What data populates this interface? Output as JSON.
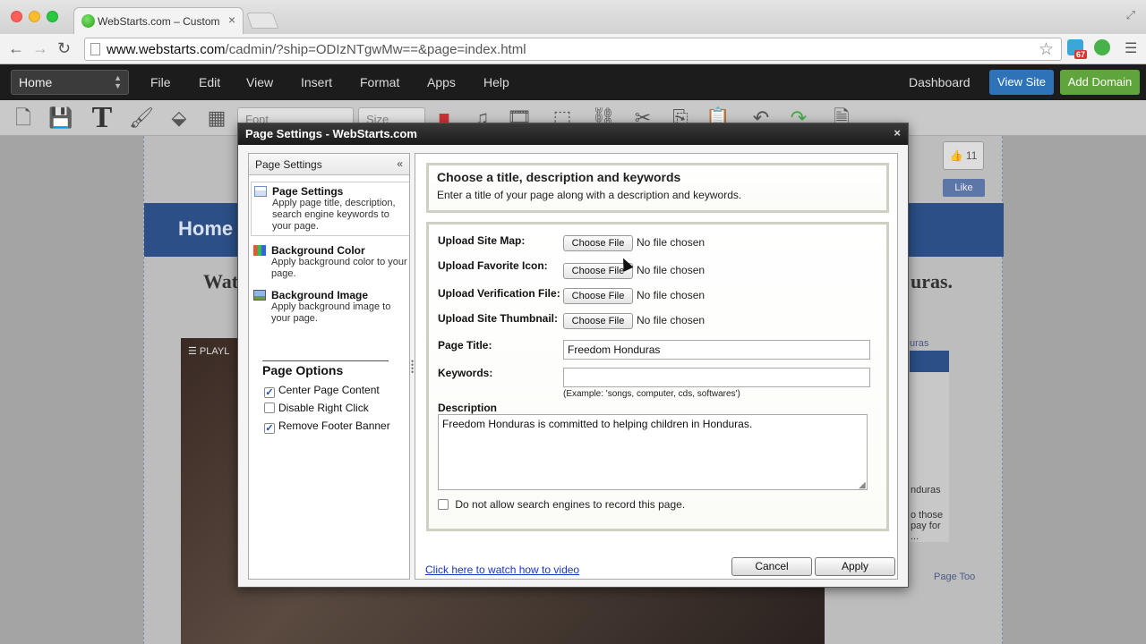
{
  "browser": {
    "tab_title": "WebStarts.com – Custom W",
    "tab_close": "×",
    "url_host": "www.webstarts.com",
    "url_path": "/cadmin/?ship=ODIzNTgwMw==&page=index.html",
    "ext_badge": "67"
  },
  "appbar": {
    "page_select": "Home",
    "menus": [
      "File",
      "Edit",
      "View",
      "Insert",
      "Format",
      "Apps",
      "Help"
    ],
    "dashboard": "Dashboard",
    "view_site": "View Site",
    "add_domain": "Add Domain"
  },
  "editor_toolbar": {
    "font_placeholder": "Font",
    "size_placeholder": "Size"
  },
  "site": {
    "nav_home": "Home",
    "heading_left": "Wat",
    "heading_right": "uras.",
    "video_label": "☰ PLAYL",
    "like_count": "11",
    "fb_like": "Like",
    "side_title": "uras",
    "side_text_1": "nduras",
    "side_text_2": "o those",
    "side_text_3": "pay for",
    "side_text_4": "...",
    "side_link": "Page Too"
  },
  "dialog": {
    "title": "Page Settings - WebStarts.com",
    "close": "×",
    "left_panel": {
      "header": "Page Settings",
      "collapse": "«",
      "items": [
        {
          "name": "Page Settings",
          "desc": "Apply page title, description, search engine keywords to your page."
        },
        {
          "name": "Background Color",
          "desc": "Apply background color to your page."
        },
        {
          "name": "Background Image",
          "desc": "Apply background image to your page."
        }
      ],
      "options_title": "Page Options",
      "options": [
        {
          "label": "Center Page Content",
          "checked": "✓"
        },
        {
          "label": "Disable Right Click",
          "checked": ""
        },
        {
          "label": "Remove Footer Banner",
          "checked": "✓"
        }
      ]
    },
    "header_box": {
      "title": "Choose a title, description and keywords",
      "subtitle": "Enter a title of your page along with a description and keywords."
    },
    "form": {
      "site_map_label": "Upload Site Map:",
      "favicon_label": "Upload Favorite Icon:",
      "verification_label": "Upload Verification File:",
      "thumbnail_label": "Upload Site Thumbnail:",
      "choose_file": "Choose File",
      "no_file": "No file chosen",
      "page_title_label": "Page Title:",
      "page_title_value": "Freedom Honduras",
      "keywords_label": "Keywords:",
      "keywords_value": "",
      "keywords_hint": "(Example: 'songs, computer, cds, softwares')",
      "description_label": "Description",
      "description_value": "Freedom Honduras is committed to helping children in Honduras.",
      "no_index_label": "Do not allow search engines to record this page."
    },
    "video_link": "Click here to watch how to video",
    "cancel": "Cancel",
    "apply": "Apply"
  }
}
